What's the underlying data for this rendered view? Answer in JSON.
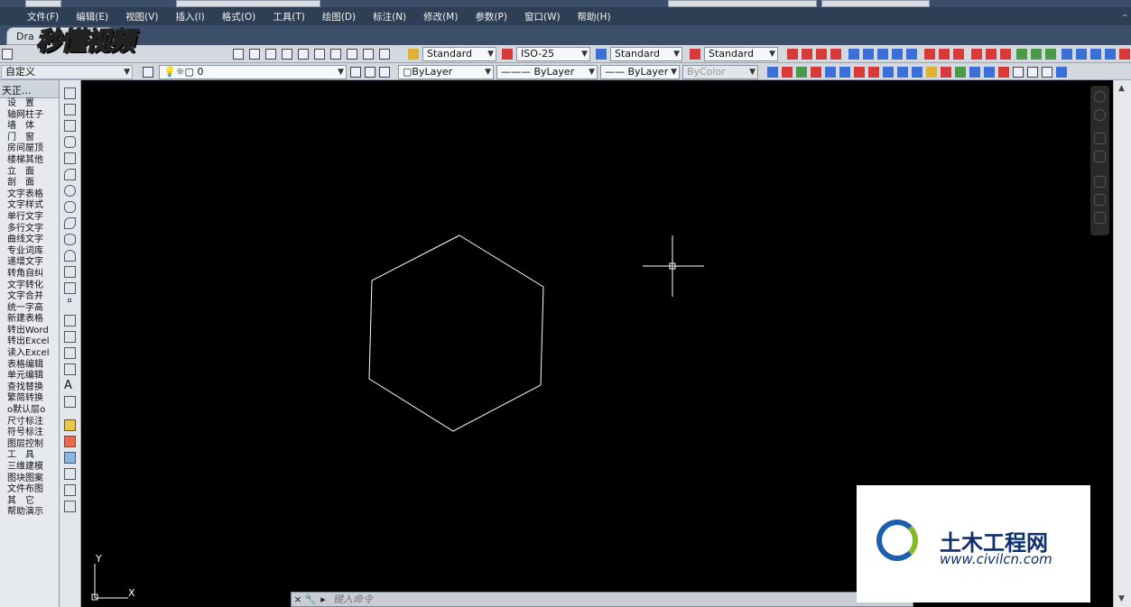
{
  "window": {
    "drawing_tab": "Dra"
  },
  "watermarks": {
    "channel_logo": "秒懂视频",
    "site_logo_cn": "土木工程网",
    "site_url": "www.civilcn.com"
  },
  "menu": {
    "items": [
      "文件(F)",
      "编辑(E)",
      "视图(V)",
      "插入(I)",
      "格式(O)",
      "工具(T)",
      "绘图(D)",
      "标注(N)",
      "修改(M)",
      "参数(P)",
      "窗口(W)",
      "帮助(H)"
    ],
    "right_ctrl": "–"
  },
  "toolbar1": {
    "text_style": "Standard",
    "dim_style": "ISO-25",
    "table_style": "Standard",
    "multileader_style": "Standard"
  },
  "toolbar2": {
    "workspace": "自定义",
    "layer": "0",
    "color": "ByLayer",
    "linetype": "ByLayer",
    "lineweight": "ByLayer",
    "plotstyle": "ByColor"
  },
  "left_palette": {
    "header": "天正...",
    "items": [
      "设　置",
      "轴网柱子",
      "墙　体",
      "门　窗",
      "房间屋顶",
      "楼梯其他",
      "立　面",
      "剖　面",
      "文字表格",
      "文字样式",
      "单行文字",
      "多行文字",
      "曲线文字",
      "专业词库",
      "递增文字",
      "转角自纠",
      "文字转化",
      "文字合并",
      "统一字高",
      "新建表格",
      "转出Word",
      "转出Excel",
      "读入Excel",
      "表格编辑",
      "单元编辑",
      "查找替换",
      "繁简转换",
      "o默认层o",
      "尺寸标注",
      "符号标注",
      "图层控制",
      "工　具",
      "三维建模",
      "图块图案",
      "文件布图",
      "其　它",
      "帮助演示"
    ]
  },
  "drawing": {
    "ucs_x": "X",
    "ucs_y": "Y"
  },
  "command": {
    "placeholder": "键入命令",
    "close_glyph": "×",
    "wrench_glyph": "🔧"
  },
  "colors": {
    "canvas_bg": "#000000",
    "geometry": "#ffffff",
    "menubar": "#2e3e55"
  }
}
